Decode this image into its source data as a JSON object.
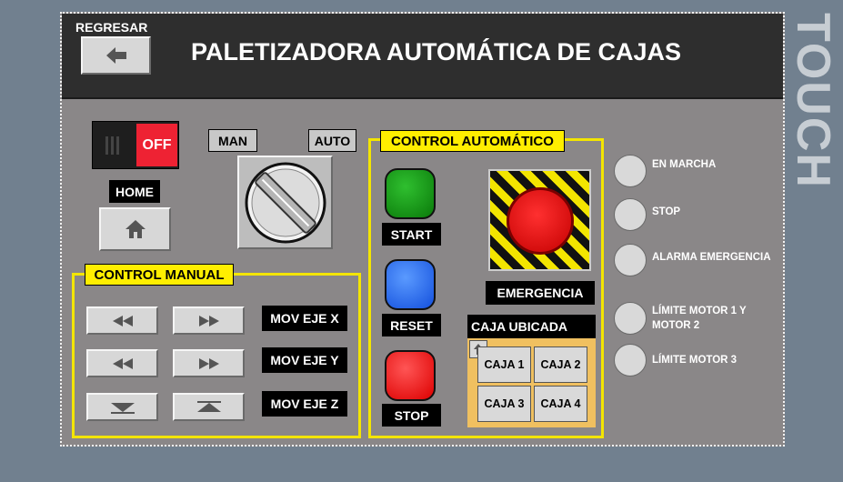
{
  "header": {
    "back_label": "REGRESAR",
    "title": "PALETIZADORA AUTOMÁTICA DE CAJAS"
  },
  "touch_label": "TOUCH",
  "mode": {
    "toggle_label": "OFF",
    "man_label": "MAN",
    "auto_label": "AUTO",
    "home_label": "HOME"
  },
  "manual": {
    "title": "CONTROL MANUAL",
    "axes": [
      {
        "label": "MOV EJE X",
        "left_icon": "rewind-icon",
        "right_icon": "fast-forward-icon"
      },
      {
        "label": "MOV EJE Y",
        "left_icon": "rewind-icon",
        "right_icon": "fast-forward-icon"
      },
      {
        "label": "MOV EJE Z",
        "left_icon": "down-icon",
        "right_icon": "up-icon"
      }
    ]
  },
  "auto": {
    "title": "CONTROL AUTOMÁTICO",
    "start_label": "START",
    "reset_label": "RESET",
    "stop_label": "STOP",
    "emergency_label": "EMERGENCIA",
    "caja_title": "CAJA UBICADA",
    "cajas": [
      "CAJA 1",
      "CAJA 2",
      "CAJA 3",
      "CAJA 4"
    ]
  },
  "indicators": [
    "EN MARCHA",
    "STOP",
    "ALARMA EMERGENCIA",
    "LÍMITE MOTOR 1 Y MOTOR 2",
    "LÍMITE MOTOR 3"
  ],
  "colors": {
    "start": "#0a8a0a",
    "reset": "#1a66ff",
    "stop": "#ff1111",
    "emergency": "#ee1111",
    "frame": "#f3e500",
    "caja_bg": "#f0c060"
  }
}
